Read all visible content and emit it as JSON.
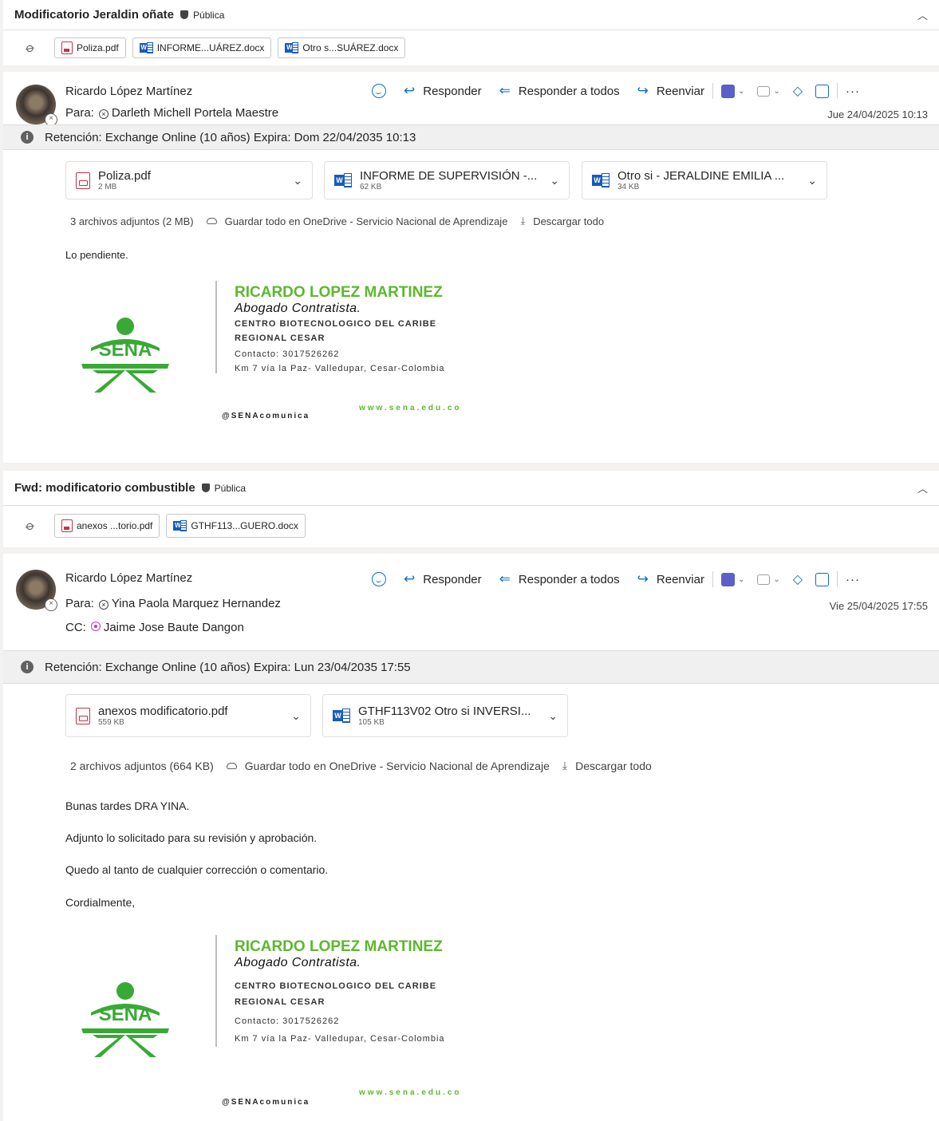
{
  "threads": [
    {
      "title": "Modificatorio Jeraldin oñate",
      "sensitivity": "Pública",
      "chips": [
        {
          "type": "pdf",
          "label": "Poliza.pdf"
        },
        {
          "type": "word",
          "label": "INFORME...UÁREZ.docx"
        },
        {
          "type": "word",
          "label": "Otro s...SUÁREZ.docx"
        }
      ]
    },
    {
      "title": "Fwd: modificatorio combustible",
      "sensitivity": "Pública",
      "chips": [
        {
          "type": "pdf",
          "label": "anexos ...torio.pdf"
        },
        {
          "type": "word",
          "label": "GTHF113...GUERO.docx"
        }
      ]
    }
  ],
  "messages": [
    {
      "sender": "Ricardo López Martínez",
      "to_label": "Para:",
      "to": "Darleth Michell Portela Maestre",
      "date": "Jue 24/04/2025 10:13",
      "actions": {
        "reply": "Responder",
        "reply_all": "Responder a todos",
        "forward": "Reenviar"
      },
      "retention": "Retención: Exchange Online (10 años) Expira: Dom 22/04/2035 10:13",
      "attachments": [
        {
          "type": "pdf",
          "name": "Poliza.pdf",
          "size": "2 MB"
        },
        {
          "type": "word",
          "name": "INFORME DE SUPERVISIÓN -...",
          "size": "62 KB"
        },
        {
          "type": "word",
          "name": "Otro si - JERALDINE EMILIA ...",
          "size": "34 KB"
        }
      ],
      "summary": {
        "count": "3 archivos adjuntos (2 MB)",
        "save": "Guardar todo en OneDrive - Servicio Nacional de Aprendizaje",
        "download": "Descargar todo"
      },
      "body": [
        "Lo pendiente."
      ]
    },
    {
      "sender": "Ricardo López Martínez",
      "to_label": "Para:",
      "to": "Yina Paola Marquez Hernandez",
      "cc_label": "CC:",
      "cc": "Jaime Jose Baute Dangon",
      "date": "Vie 25/04/2025 17:55",
      "actions": {
        "reply": "Responder",
        "reply_all": "Responder a todos",
        "forward": "Reenviar"
      },
      "retention": "Retención: Exchange Online (10 años) Expira: Lun 23/04/2035 17:55",
      "attachments": [
        {
          "type": "pdf",
          "name": "anexos modificatorio.pdf",
          "size": "559 KB"
        },
        {
          "type": "word",
          "name": "GTHF113V02 Otro si INVERSI...",
          "size": "105 KB"
        }
      ],
      "summary": {
        "count": "2 archivos adjuntos (664 KB)",
        "save": "Guardar todo en OneDrive - Servicio Nacional de Aprendizaje",
        "download": "Descargar todo"
      },
      "body": [
        "Bunas tardes DRA YINA.",
        "Adjunto lo solicitado para su revisión y aprobación.",
        "Quedo al tanto de cualquier corrección o comentario.",
        "Cordialmente,"
      ]
    }
  ],
  "signature": {
    "name": "RICARDO LOPEZ MARTINEZ",
    "role": "Abogado Contratista.",
    "lines": [
      "CENTRO BIOTECNOLOGICO DEL CARIBE",
      "REGIONAL CESAR",
      "Contacto: 3017526262",
      "Km 7 vía la Paz- Valledupar, Cesar-Colombia"
    ],
    "social": "@SENAcomunica",
    "web": "www.sena.edu.co",
    "logo_text": "SENA"
  },
  "colors": {
    "accent": "#0f6cbd",
    "sena_green": "#5cb82e",
    "logo_green": "#39a935",
    "pdf_red": "#c4314b",
    "word_blue": "#185abd"
  }
}
